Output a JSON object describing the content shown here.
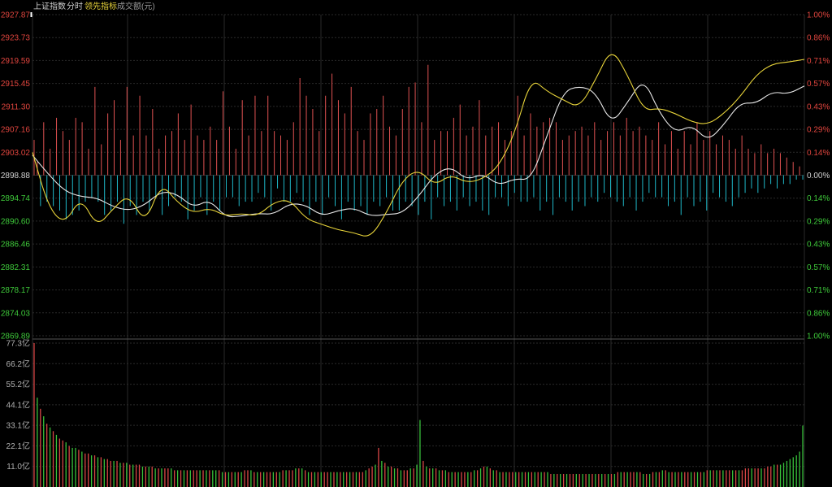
{
  "header": {
    "index_name": "上证指数",
    "period": "分时",
    "leading_indicator": "领先指标",
    "volume_label": "成交额(元)"
  },
  "colors": {
    "background": "#000000",
    "grid": "#2a2a2a",
    "up": "#e05252",
    "down": "#1fb8c8",
    "price_line": "#e8e8e8",
    "leading_line": "#e8d43a",
    "up_text": "#e0453e",
    "down_text": "#3ec83a",
    "neutral_text": "#d0d0d0",
    "vol_up": "#d94646",
    "vol_down": "#38c23a"
  },
  "chart_data": [
    {
      "type": "line",
      "name": "intraday",
      "ylim": [
        2869.89,
        2927.87
      ],
      "prev_close": 2898.88,
      "y_ticks_left": [
        "2927.87",
        "2923.73",
        "2919.59",
        "2915.45",
        "2911.30",
        "2907.16",
        "2903.02",
        "2898.88",
        "2894.74",
        "2890.60",
        "2886.46",
        "2882.31",
        "2878.17",
        "2874.03",
        "2869.89"
      ],
      "y_ticks_right": [
        "1.00%",
        "0.86%",
        "0.71%",
        "0.57%",
        "0.43%",
        "0.29%",
        "0.14%",
        "0.00%",
        "0.14%",
        "0.29%",
        "0.43%",
        "0.57%",
        "0.71%",
        "0.86%",
        "1.00%"
      ],
      "x": [
        0,
        5,
        10,
        15,
        20,
        25,
        30,
        35,
        40,
        45,
        50,
        55,
        60,
        65,
        70,
        75,
        80,
        85,
        90,
        95,
        100,
        105,
        110,
        115,
        120,
        125,
        130,
        135,
        140,
        145,
        150,
        155,
        160,
        165,
        170,
        175,
        180,
        185,
        190,
        195,
        200,
        205,
        210,
        215,
        220,
        225,
        230,
        235,
        240
      ],
      "series": [
        {
          "values": [
            2902.5,
            2899.0,
            2896.0,
            2895.0,
            2894.8,
            2893.2,
            2892.5,
            2893.5,
            2896.0,
            2895.5,
            2893.0,
            2894.5,
            2891.3,
            2891.5,
            2892.0,
            2891.8,
            2893.8,
            2893.5,
            2891.5,
            2892.5,
            2893.0,
            2891.5,
            2891.8,
            2892.0,
            2895.0,
            2899.0,
            2900.5,
            2898.0,
            2899.2,
            2897.0,
            2898.3,
            2898.0,
            2906.0,
            2914.0,
            2915.0,
            2914.0,
            2908.0,
            2912.0,
            2916.5,
            2910.0,
            2906.5,
            2908.0,
            2905.0,
            2908.0,
            2912.0,
            2911.8,
            2914.0,
            2913.5,
            2915.0
          ]
        },
        {
          "values": [
            2903.0,
            2893.0,
            2890.0,
            2895.0,
            2889.5,
            2892.8,
            2895.5,
            2890.0,
            2897.5,
            2894.0,
            2892.0,
            2893.0,
            2891.5,
            2892.0,
            2891.5,
            2894.0,
            2894.5,
            2891.0,
            2890.0,
            2889.0,
            2888.5,
            2887.5,
            2892.0,
            2898.0,
            2900.0,
            2897.0,
            2899.0,
            2897.5,
            2898.2,
            2900.5,
            2906.5,
            2916.5,
            2914.0,
            2912.5,
            2911.0,
            2916.0,
            2922.0,
            2917.0,
            2910.5,
            2911.0,
            2910.0,
            2908.5,
            2908.0,
            2910.0,
            2913.0,
            2917.0,
            2919.0,
            2919.3,
            2919.8
          ]
        }
      ]
    },
    {
      "type": "bar",
      "name": "breadth",
      "values": [
        8,
        3,
        -7,
        12,
        -6,
        6,
        -7,
        13,
        -8,
        10,
        -10,
        8,
        -9,
        13,
        -8,
        12,
        -6,
        6,
        -5,
        20,
        -6,
        7,
        -9,
        14,
        -8,
        17,
        -6,
        8,
        -11,
        20,
        -7,
        9,
        -9,
        18,
        -6,
        9,
        -8,
        15,
        -5,
        6,
        -9,
        9,
        -7,
        10,
        -5,
        14,
        -6,
        8,
        -10,
        16,
        -8,
        9,
        -5,
        8,
        -9,
        11,
        -6,
        8,
        -8,
        19,
        -5,
        11,
        -5,
        6,
        -7,
        17,
        -6,
        9,
        -6,
        18,
        -4,
        10,
        -5,
        18,
        -8,
        10,
        -3,
        9,
        -6,
        8,
        -6,
        12,
        -4,
        22,
        -6,
        18,
        -9,
        15,
        -6,
        10,
        -9,
        18,
        -5,
        23,
        -7,
        17,
        -10,
        14,
        -6,
        20,
        -8,
        10,
        -7,
        8,
        -9,
        14,
        -6,
        15,
        -7,
        18,
        -5,
        11,
        -8,
        9,
        -8,
        15,
        -6,
        20,
        -7,
        21,
        -9,
        12,
        -6,
        25,
        -10,
        8,
        -5,
        10,
        -7,
        10,
        -6,
        13,
        -8,
        16,
        -5,
        9,
        -7,
        11,
        -6,
        17,
        -8,
        9,
        -9,
        11,
        -5,
        12,
        -5,
        8,
        -7,
        10,
        -4,
        18,
        -6,
        9,
        -6,
        14,
        -5,
        11,
        -8,
        12,
        -6,
        13,
        -9,
        12,
        -5,
        8,
        -6,
        9,
        -8,
        10,
        -6,
        11,
        -7,
        9,
        -5,
        12,
        -6,
        8,
        -4,
        10,
        -5,
        12,
        -6,
        9,
        -7,
        13,
        -5,
        10,
        -8,
        11,
        -6,
        9,
        -4,
        8,
        -5,
        12,
        -5,
        7,
        -7,
        10,
        -6,
        6,
        -9,
        10,
        -5,
        7,
        -7,
        12,
        -6,
        8,
        -8,
        10,
        -4,
        7,
        -5,
        9,
        -6,
        8,
        -7,
        6,
        -5,
        9,
        -4,
        6,
        -3,
        5,
        -4,
        7,
        -3,
        5,
        -2,
        6,
        -3,
        5,
        -2,
        4,
        -2,
        3,
        -1,
        2,
        -1
      ],
      "ylim": [
        -20,
        20
      ]
    },
    {
      "type": "bar",
      "name": "turnover",
      "ylim": [
        0,
        77.3
      ],
      "y_ticks": [
        "77.3亿",
        "66.2亿",
        "55.2亿",
        "44.1亿",
        "33.1亿",
        "22.1亿",
        "11.0亿"
      ],
      "values": [
        77.3,
        48,
        42,
        38,
        34,
        32,
        30,
        28,
        26,
        25,
        24,
        22,
        21,
        21,
        20,
        19,
        18,
        18,
        17,
        17,
        16,
        16,
        15,
        15,
        14,
        14,
        14,
        13,
        13,
        13,
        12,
        12,
        12,
        12,
        11,
        11,
        11,
        11,
        10,
        10,
        10,
        10,
        10,
        10,
        9,
        9,
        9,
        9,
        9,
        9,
        9,
        9,
        9,
        9,
        9,
        9,
        9,
        9,
        9,
        8,
        8,
        8,
        8,
        8,
        8,
        8,
        9,
        9,
        9,
        8,
        8,
        8,
        8,
        8,
        8,
        8,
        8,
        8,
        9,
        9,
        9,
        9,
        10,
        10,
        10,
        9,
        8,
        8,
        8,
        8,
        8,
        8,
        8,
        8,
        8,
        8,
        8,
        8,
        8,
        8,
        8,
        8,
        8,
        8,
        9,
        10,
        11,
        12,
        21,
        14,
        13,
        11,
        11,
        10,
        10,
        9,
        9,
        9,
        10,
        10,
        12,
        36,
        14,
        11,
        10,
        10,
        10,
        9,
        9,
        9,
        8,
        8,
        8,
        8,
        8,
        8,
        8,
        8,
        9,
        9,
        10,
        11,
        11,
        10,
        9,
        9,
        8,
        8,
        8,
        8,
        8,
        8,
        8,
        8,
        8,
        8,
        8,
        8,
        8,
        8,
        8,
        8,
        7,
        7,
        7,
        7,
        7,
        7,
        7,
        7,
        7,
        7,
        7,
        7,
        7,
        7,
        7,
        7,
        7,
        7,
        7,
        7,
        7,
        8,
        8,
        8,
        8,
        8,
        8,
        8,
        8,
        7,
        7,
        7,
        8,
        8,
        8,
        9,
        9,
        8,
        8,
        8,
        8,
        8,
        8,
        8,
        8,
        8,
        8,
        8,
        8,
        9,
        9,
        9,
        9,
        9,
        9,
        9,
        9,
        9,
        9,
        9,
        9,
        10,
        10,
        10,
        10,
        10,
        10,
        10,
        11,
        11,
        12,
        12,
        12,
        13,
        14,
        15,
        16,
        17,
        19,
        33
      ],
      "up": [
        1,
        0,
        1,
        0,
        1,
        0,
        1,
        0,
        1,
        1,
        0,
        1,
        0,
        0,
        1,
        0,
        1,
        1,
        0,
        1,
        0,
        1,
        0,
        1,
        1,
        0,
        1,
        0,
        1,
        0,
        1,
        0,
        1,
        1,
        0,
        1,
        0,
        1,
        0,
        1,
        0,
        1,
        1,
        0,
        1,
        0,
        1,
        0,
        1,
        0,
        1,
        1,
        0,
        1,
        0,
        1,
        0,
        0,
        1,
        0,
        1,
        0,
        1,
        0,
        1,
        0,
        1,
        1,
        0,
        1,
        0,
        1,
        0,
        1,
        1,
        0,
        1,
        0,
        1,
        0,
        1,
        1,
        0,
        1,
        0,
        1,
        0,
        1,
        0,
        1,
        0,
        1,
        1,
        0,
        1,
        0,
        1,
        0,
        1,
        0,
        1,
        0,
        1,
        1,
        0,
        1,
        1,
        0,
        1,
        0,
        1,
        0,
        1,
        0,
        1,
        0,
        1,
        1,
        0,
        1,
        0,
        0,
        1,
        0,
        1,
        0,
        1,
        0,
        1,
        0,
        1,
        0,
        1,
        0,
        1,
        1,
        0,
        1,
        0,
        1,
        0,
        1,
        0,
        1,
        0,
        1,
        0,
        1,
        0,
        1,
        1,
        0,
        1,
        0,
        1,
        0,
        1,
        0,
        1,
        0,
        1,
        0,
        1,
        0,
        1,
        0,
        1,
        0,
        1,
        1,
        0,
        1,
        0,
        1,
        0,
        1,
        0,
        1,
        0,
        1,
        0,
        1,
        0,
        1,
        0,
        1,
        0,
        1,
        1,
        0,
        1,
        0,
        1,
        0,
        1,
        0,
        1,
        0,
        1,
        0,
        1,
        0,
        1,
        0,
        1,
        1,
        0,
        1,
        0,
        1,
        0,
        1,
        0,
        1,
        0,
        1,
        0,
        1,
        1,
        0,
        1,
        0,
        1,
        1,
        1,
        0,
        1,
        1,
        0,
        1,
        1,
        1,
        0,
        1,
        0
      ]
    }
  ]
}
